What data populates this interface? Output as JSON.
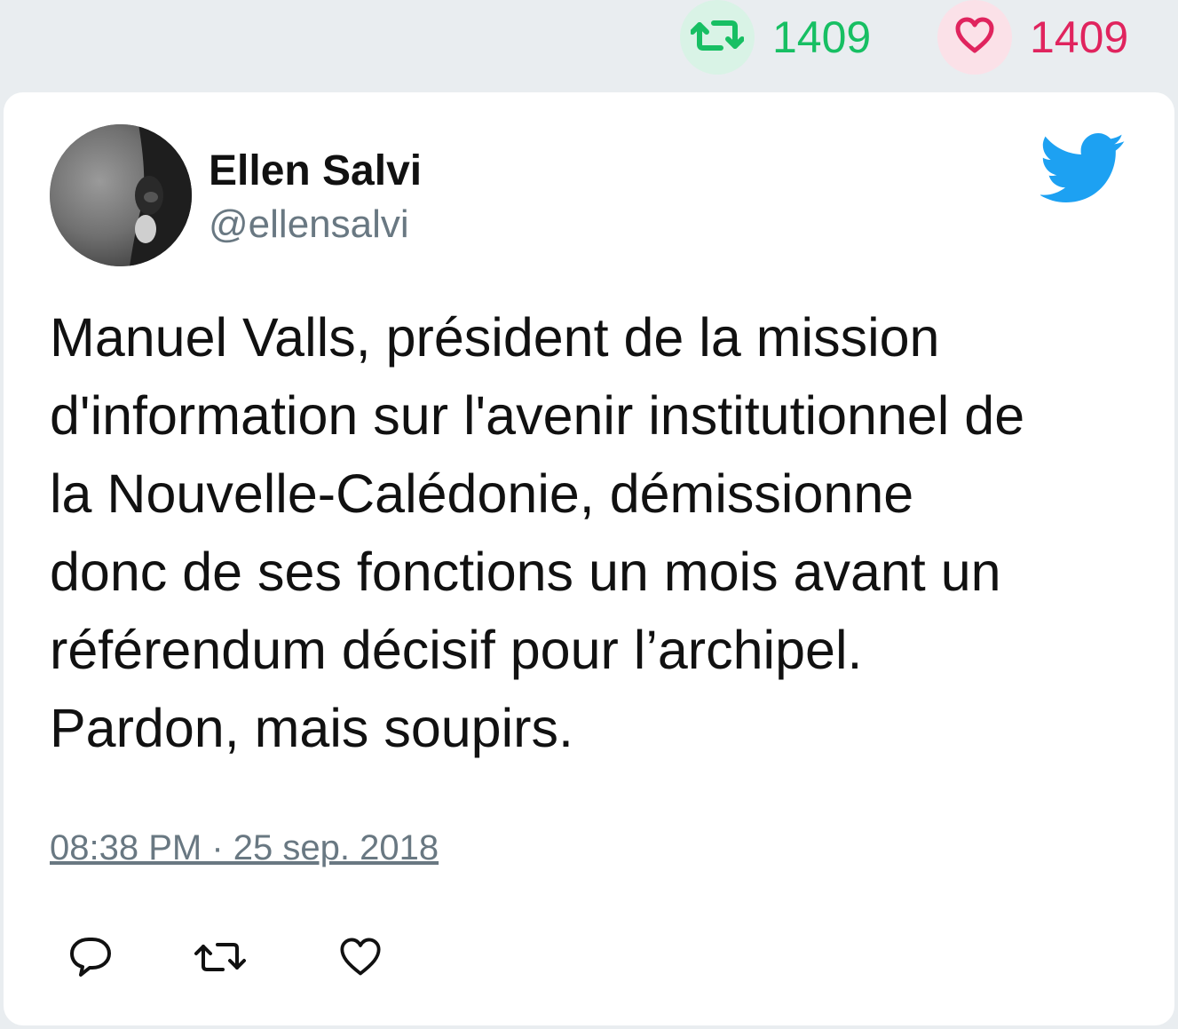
{
  "top_stats": {
    "retweet_count": "1409",
    "like_count": "1409"
  },
  "tweet": {
    "display_name": "Ellen Salvi",
    "handle": "@ellensalvi",
    "text": "Manuel Valls, président de la mission\nd'information sur l'avenir institutionnel de\nla Nouvelle-Calédonie, démissionne\ndonc de ses fonctions un mois avant un\nréférendum décisif pour l’archipel.\nPardon, mais soupirs.",
    "timestamp": "08:38 PM · 25 sep. 2018"
  },
  "icons": {
    "retweet_stat": "retweet-icon",
    "like_stat": "heart-icon",
    "brand": "twitter-bird-icon",
    "reply_action": "reply-icon",
    "retweet_action": "retweet-icon",
    "like_action": "heart-icon"
  },
  "colors": {
    "retweet": "#17bf63",
    "like": "#e0245e",
    "brand": "#1da1f2",
    "muted": "#697882",
    "background": "#e9edf0"
  }
}
